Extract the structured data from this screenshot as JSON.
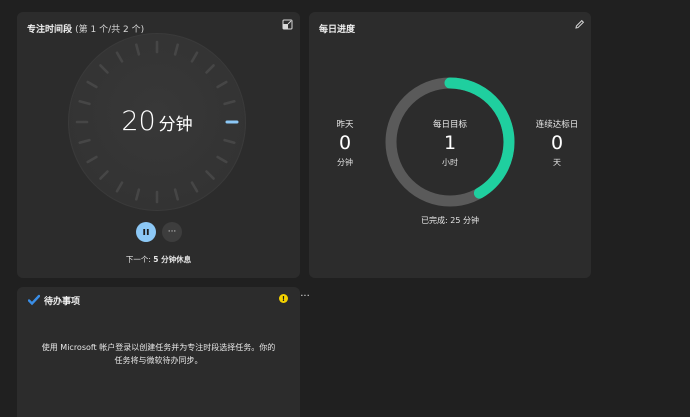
{
  "focus": {
    "title": "专注时间段",
    "subtitle": "(第 1 个/共 2 个)",
    "timer_value": "20",
    "timer_unit": "分钟",
    "next_prefix": "下一个:",
    "next_value": "5 分钟休息",
    "more_glyph": "···",
    "accent_color": "#8cc8f6"
  },
  "progress": {
    "title": "每日进度",
    "yesterday": {
      "label": "昨天",
      "value": "0",
      "unit": "分钟"
    },
    "goal": {
      "label": "每日目标",
      "value": "1",
      "unit": "小时"
    },
    "streak": {
      "label": "连续达标日",
      "value": "0",
      "unit": "天"
    },
    "completed_text": "已完成: 25 分钟",
    "completed_fraction": 0.4167,
    "ring_color": "#1fcf9f",
    "track_color": "#5a5a5a"
  },
  "todo": {
    "title": "待办事项",
    "warning_glyph": "!",
    "more_glyph": "···",
    "body_text": "使用 Microsoft 帐户登录以创建任务并为专注时段选择任务。你的任务将与微软待办同步。"
  }
}
